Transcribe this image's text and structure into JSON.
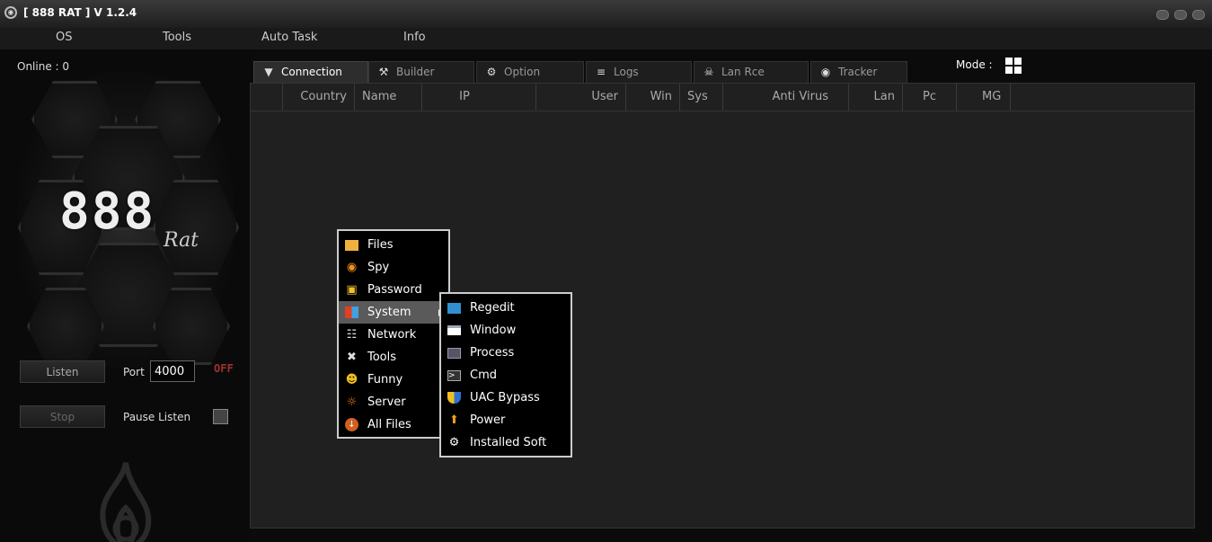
{
  "window": {
    "title": "[ 888 RAT ] V 1.2.4"
  },
  "menu": [
    "OS",
    "Tools",
    "Auto Task",
    "Info"
  ],
  "sidebar": {
    "online_label": "Online : 0",
    "logo_number": "888",
    "logo_text": "Rat",
    "listen_button": "Listen",
    "port_label": "Port",
    "port_value": "4000",
    "status": "OFF",
    "stop_button": "Stop",
    "pause_label": "Pause Listen"
  },
  "tabs": [
    {
      "label": "Connection",
      "icon": "plug-icon",
      "active": true
    },
    {
      "label": "Builder",
      "icon": "tools-icon"
    },
    {
      "label": "Option",
      "icon": "gear-icon"
    },
    {
      "label": "Logs",
      "icon": "database-icon"
    },
    {
      "label": "Lan Rce",
      "icon": "skull-icon"
    },
    {
      "label": "Tracker",
      "icon": "globe-icon"
    }
  ],
  "mode": {
    "label": "Mode :",
    "icon": "windows-icon"
  },
  "columns": [
    "Country",
    "Name",
    "IP",
    "User",
    "Win",
    "Sys",
    "Anti Virus",
    "Lan",
    "Pc",
    "MG"
  ],
  "context_menu": {
    "items": [
      {
        "label": "Files",
        "icon": "folder-icon"
      },
      {
        "label": "Spy",
        "icon": "eye-icon"
      },
      {
        "label": "Password",
        "icon": "lock-icon"
      },
      {
        "label": "System",
        "icon": "windows-icon",
        "highlighted": true,
        "submenu": true
      },
      {
        "label": "Network",
        "icon": "network-icon"
      },
      {
        "label": "Tools",
        "icon": "tools-icon"
      },
      {
        "label": "Funny",
        "icon": "smiley-icon"
      },
      {
        "label": "Server",
        "icon": "sun-icon"
      },
      {
        "label": "All Files",
        "icon": "download-icon"
      }
    ],
    "submenu": [
      {
        "label": "Regedit",
        "icon": "registry-icon"
      },
      {
        "label": "Window",
        "icon": "window-icon"
      },
      {
        "label": "Process",
        "icon": "process-icon"
      },
      {
        "label": "Cmd",
        "icon": "terminal-icon"
      },
      {
        "label": "UAC Bypass",
        "icon": "shield-icon"
      },
      {
        "label": "Power",
        "icon": "lightning-icon"
      },
      {
        "label": "Installed Soft",
        "icon": "gear-icon"
      }
    ]
  },
  "colors": {
    "status_off": "#a03030",
    "accent_orange": "#f0a020",
    "background": "#0b0b0b"
  }
}
